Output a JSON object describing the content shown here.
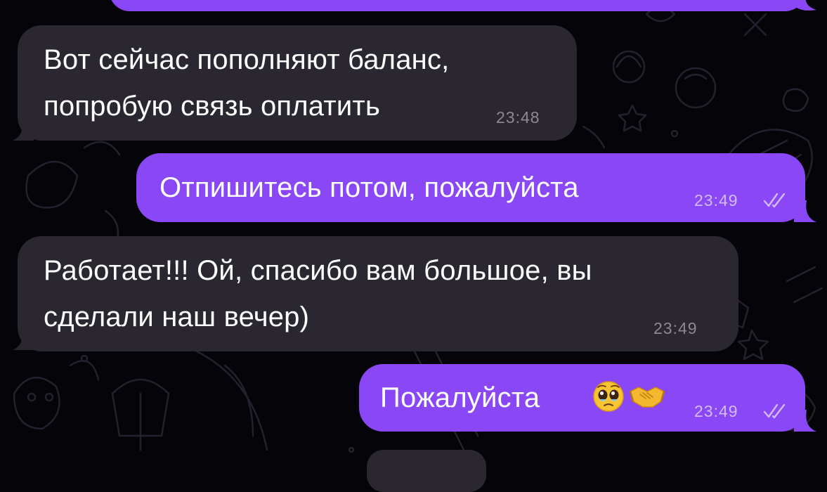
{
  "theme": {
    "background": "#050408",
    "incoming_bubble": "#2b2730",
    "outgoing_bubble": "#8a47f5",
    "incoming_time_color": "#8d8896",
    "outgoing_time_color": "#d2bcff"
  },
  "messages": [
    {
      "direction": "incoming",
      "lines": [
        "Вот сейчас пополняют баланс,",
        "попробую связь оплатить"
      ],
      "time": "23:48"
    },
    {
      "direction": "outgoing",
      "lines": [
        "Отпишитесь потом, пожалуйста"
      ],
      "time": "23:49",
      "status_icon": "double-check-icon"
    },
    {
      "direction": "incoming",
      "lines": [
        "Работает!!! Ой, спасибо вам большое, вы",
        "сделали наш вечер)"
      ],
      "time": "23:49"
    },
    {
      "direction": "outgoing",
      "lines": [
        "Пожалуйста"
      ],
      "emojis": [
        "pleading-face-emoji",
        "handshake-emoji"
      ],
      "time": "23:49",
      "status_icon": "double-check-icon"
    }
  ]
}
